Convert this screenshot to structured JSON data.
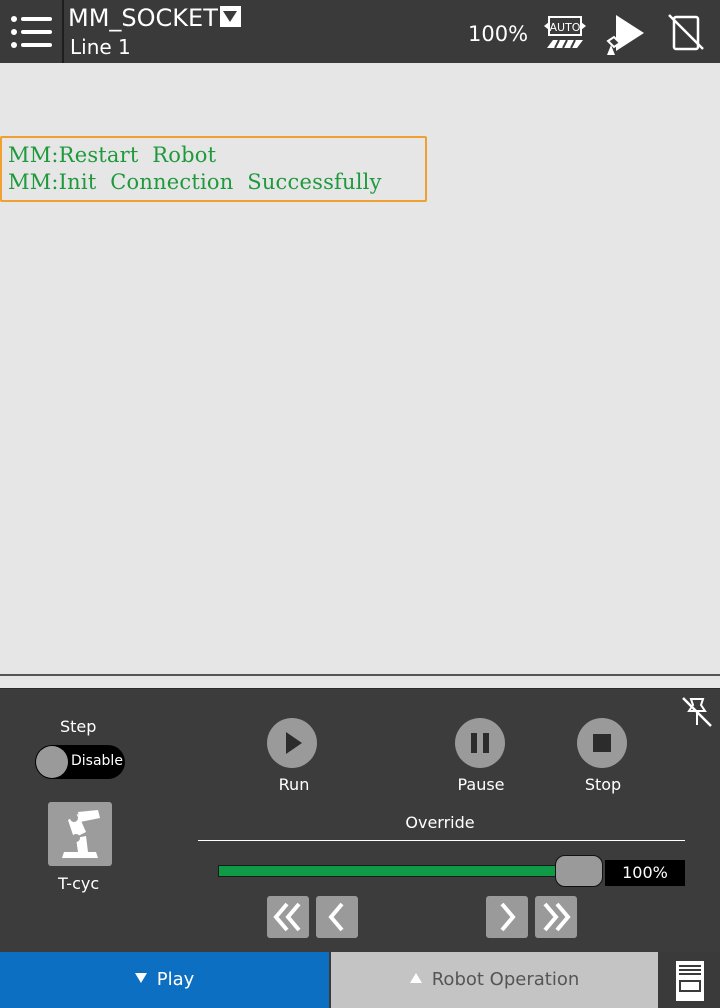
{
  "header": {
    "program_name": "MM_SOCKET",
    "line": "Line 1",
    "override": "100%",
    "icons": [
      "menu-icon",
      "auto-mode-icon",
      "robot-play-icon",
      "no-teach-pendant-icon"
    ]
  },
  "messages": [
    "MM:Restart  Robot",
    "MM:Init  Connection  Successfully"
  ],
  "colors": {
    "message_text": "#1e9a3c",
    "message_border": "#f0a030",
    "play_tab": "#0d6fc1",
    "override_bar": "#0f9a47"
  },
  "control": {
    "step_label": "Step",
    "step_toggle": "Disable",
    "tcyc_label": "T-cyc",
    "run_label": "Run",
    "pause_label": "Pause",
    "stop_label": "Stop",
    "override_label": "Override",
    "override_value": "100%",
    "override_fraction": 1.0
  },
  "tabs": {
    "play": "Play",
    "robot_operation": "Robot Operation"
  }
}
